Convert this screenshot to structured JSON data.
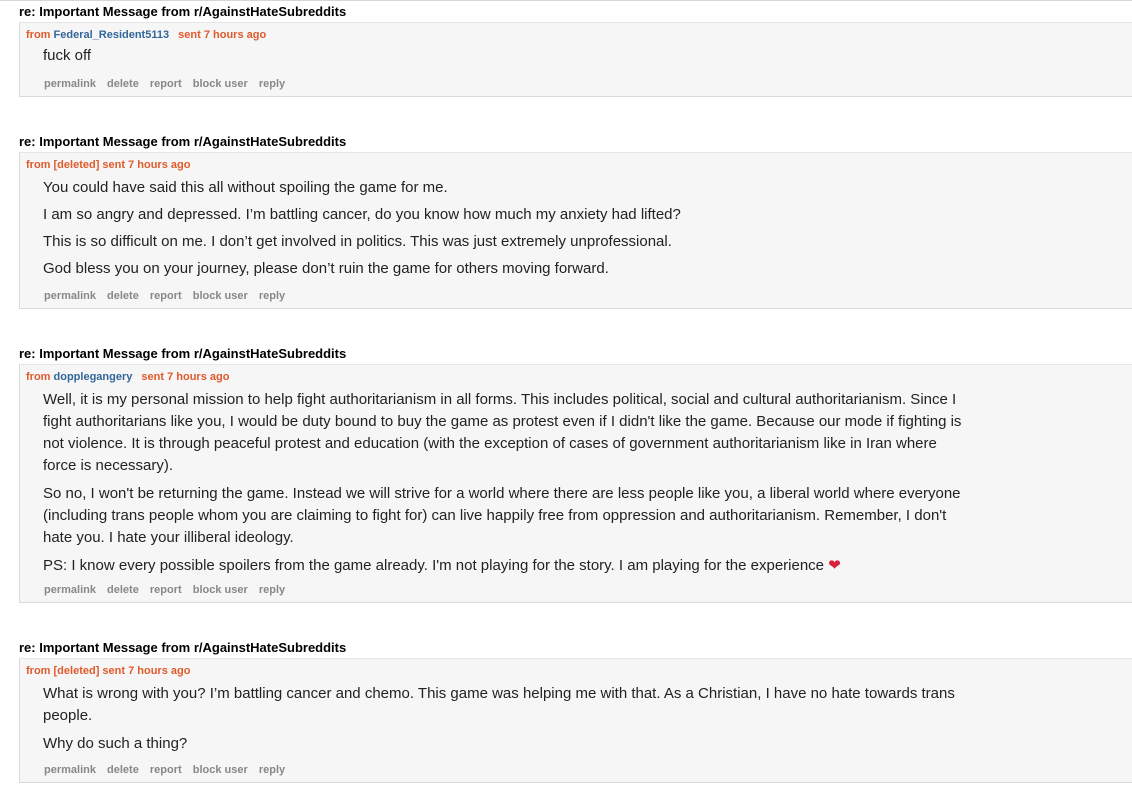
{
  "messages": [
    {
      "subject": "re: Important Message from r/AgainstHateSubreddits",
      "from_label": "from",
      "author": "Federal_Resident5113",
      "sent": "sent 7 hours ago",
      "paragraphs": [
        "fuck off"
      ]
    },
    {
      "subject": "re: Important Message from r/AgainstHateSubreddits",
      "from_label": "from",
      "author": "[deleted]",
      "sent": "sent 7 hours ago",
      "paragraphs": [
        "You could have said this all without spoiling the game for me.",
        "I am so angry and depressed. I’m battling cancer, do you know how much my anxiety had lifted?",
        "This is so difficult on me. I don’t get involved in politics. This was just extremely unprofessional.",
        "God bless you on your journey, please don’t ruin the game for others moving forward."
      ]
    },
    {
      "subject": "re: Important Message from r/AgainstHateSubreddits",
      "from_label": "from",
      "author": "dopplegangery",
      "sent": "sent 7 hours ago",
      "paragraphs": [
        "Well, it is my personal mission to help fight authoritarianism in all forms. This includes political, social and cultural authoritarianism. Since I fight authoritarians like you, I would be duty bound to buy the game as protest even if I didn't like the game. Because our mode if fighting is not violence. It is through peaceful protest and education (with the exception of cases of government authoritarianism like in Iran where force is necessary).",
        "So no, I won't be returning the game. Instead we will strive for a world where there are less people like you, a liberal world where everyone (including trans people whom you are claiming to fight for) can live happily free from oppression and authoritarianism. Remember, I don't hate you. I hate your illiberal ideology.",
        "PS: I know every possible spoilers from the game already. I'm not playing for the story. I am playing for the experience"
      ],
      "heart_icon": "heart-icon"
    },
    {
      "subject": "re: Important Message from r/AgainstHateSubreddits",
      "from_label": "from",
      "author": "[deleted]",
      "sent": "sent 7 hours ago",
      "paragraphs": [
        "What is wrong with you? I’m battling cancer and chemo. This game was helping me with that. As a Christian, I have no hate towards trans people.",
        "Why do such a thing?"
      ]
    }
  ],
  "actions": {
    "permalink": "permalink",
    "delete": "delete",
    "report": "report",
    "block_user": "block user",
    "reply": "reply"
  },
  "colors": {
    "tagline": "#e05a2b",
    "author_link": "#336699",
    "actions": "#888888",
    "box_bg": "#f6f6f6",
    "heart": "#d9213d"
  }
}
